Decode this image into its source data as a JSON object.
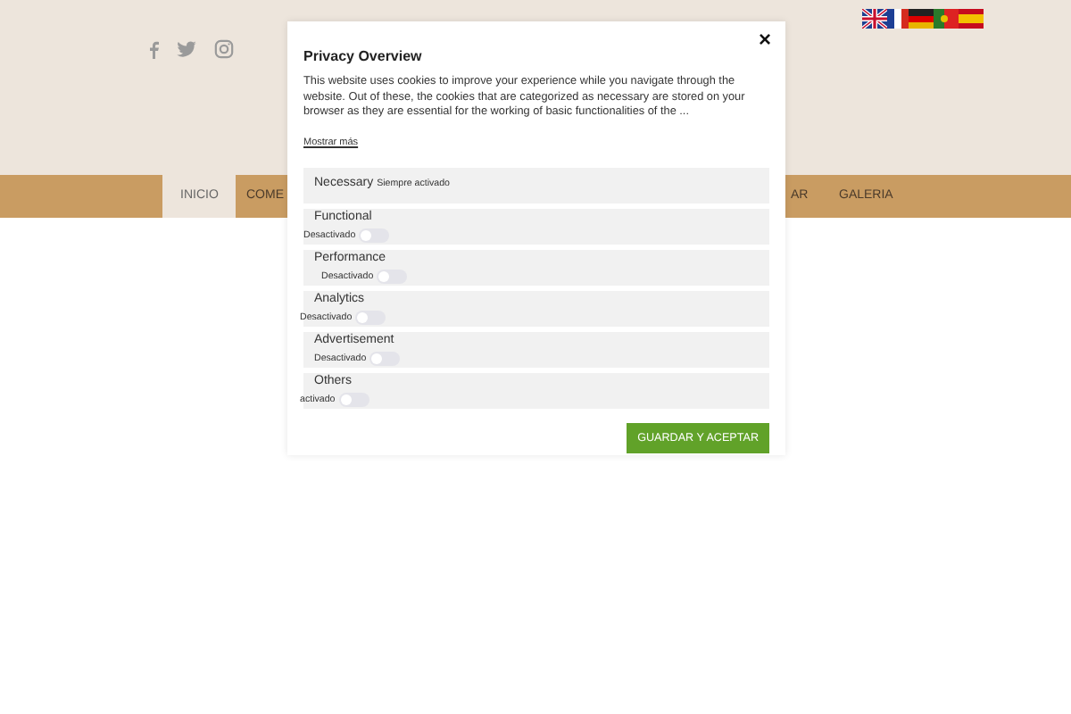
{
  "nav": {
    "items": [
      {
        "label": "INICIO",
        "selected": true
      },
      {
        "label": "COME",
        "selected": false
      },
      {
        "label": "AR",
        "selected": false
      },
      {
        "label": "GALERIA",
        "selected": false
      }
    ]
  },
  "modal": {
    "title": "Privacy Overview",
    "close": "×",
    "description": "This website uses cookies to improve your experience while you navigate through the website. Out of these, the cookies that are categorized as necessary are stored on your browser as they are essential for the working of basic functionalities of the ...",
    "more_link": "Mostrar más",
    "categories": [
      {
        "kind": "always",
        "name": "Necessary",
        "status": "Siempre activado"
      },
      {
        "kind": "toggle",
        "name": "Functional",
        "status": "Desactivado",
        "checked": false
      },
      {
        "kind": "toggle",
        "name": "Performance",
        "status": "Desactivado",
        "checked": false
      },
      {
        "kind": "toggle",
        "name": "Analytics",
        "status": "Desactivado",
        "checked": false
      },
      {
        "kind": "toggle",
        "name": "Advertisement",
        "status": "Desactivado",
        "checked": false
      },
      {
        "kind": "toggle",
        "name": "Others",
        "status": "activado",
        "checked": false
      }
    ],
    "save_button": "GUARDAR Y ACEPTAR"
  }
}
